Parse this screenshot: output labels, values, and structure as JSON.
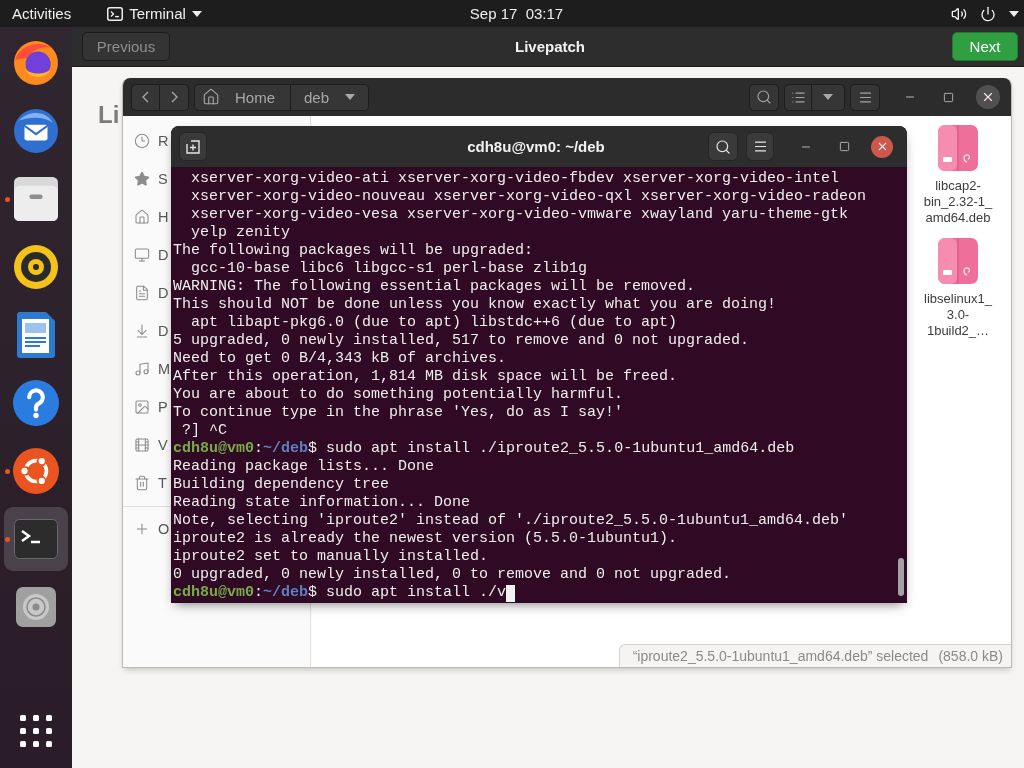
{
  "top_bar": {
    "activities": "Activities",
    "app_menu": "Terminal",
    "clock": "Sep 17  03:17"
  },
  "dock": {
    "items": [
      {
        "kind": "browser",
        "running": false,
        "active": false
      },
      {
        "kind": "mail",
        "running": false,
        "active": false
      },
      {
        "kind": "files",
        "running": true,
        "active": false
      },
      {
        "kind": "music",
        "running": false,
        "active": false
      },
      {
        "kind": "writer",
        "running": false,
        "active": false
      },
      {
        "kind": "help",
        "running": false,
        "active": false
      },
      {
        "kind": "software",
        "running": true,
        "active": false
      },
      {
        "kind": "terminal",
        "running": true,
        "active": true
      },
      {
        "kind": "disc",
        "running": false,
        "active": false
      }
    ]
  },
  "livepatch": {
    "previous": "Previous",
    "title": "Livepatch",
    "next": "Next",
    "heading": "Li"
  },
  "files_window": {
    "path": [
      {
        "kind": "home",
        "label": "Home"
      },
      {
        "kind": "current",
        "label": "deb"
      }
    ],
    "sidebar": {
      "items": [
        {
          "kind": "recent",
          "label": "R"
        },
        {
          "kind": "starred",
          "label": "S"
        },
        {
          "kind": "home",
          "label": "H"
        },
        {
          "kind": "desktop",
          "label": "D"
        },
        {
          "kind": "documents",
          "label": "D"
        },
        {
          "kind": "downloads",
          "label": "D"
        },
        {
          "kind": "music",
          "label": "M"
        },
        {
          "kind": "pictures",
          "label": "P"
        },
        {
          "kind": "videos",
          "label": "V"
        },
        {
          "kind": "trash",
          "label": "T"
        },
        {
          "kind": "other",
          "label": "O"
        }
      ]
    },
    "files": [
      {
        "name": "libcap2-\nbin_2.32-1_\namd64.deb"
      },
      {
        "name": "libselinux1_\n3.0-\n1build2_…"
      }
    ],
    "status": {
      "selection": "“iproute2_5.5.0-1ubuntu1_amd64.deb” selected",
      "size": "(858.0 kB)"
    }
  },
  "terminal": {
    "title": "cdh8u@vm0: ~/deb",
    "lines": [
      {
        "kind": "indented",
        "text": "xserver-xorg-video-ati xserver-xorg-video-fbdev xserver-xorg-video-intel"
      },
      {
        "kind": "indented",
        "text": "xserver-xorg-video-nouveau xserver-xorg-video-qxl xserver-xorg-video-radeon"
      },
      {
        "kind": "indented",
        "text": "xserver-xorg-video-vesa xserver-xorg-video-vmware xwayland yaru-theme-gtk"
      },
      {
        "kind": "indented",
        "text": "yelp zenity"
      },
      {
        "kind": "output",
        "text": "The following packages will be upgraded:"
      },
      {
        "kind": "indented",
        "text": "gcc-10-base libc6 libgcc-s1 perl-base zlib1g"
      },
      {
        "kind": "output",
        "text": "WARNING: The following essential packages will be removed."
      },
      {
        "kind": "output",
        "text": "This should NOT be done unless you know exactly what you are doing!"
      },
      {
        "kind": "indented",
        "text": "apt libapt-pkg6.0 (due to apt) libstdc++6 (due to apt)"
      },
      {
        "kind": "output",
        "text": "5 upgraded, 0 newly installed, 517 to remove and 0 not upgraded."
      },
      {
        "kind": "output",
        "text": "Need to get 0 B/4,343 kB of archives."
      },
      {
        "kind": "output",
        "text": "After this operation, 1,814 MB disk space will be freed."
      },
      {
        "kind": "output",
        "text": "You are about to do something potentially harmful."
      },
      {
        "kind": "output",
        "text": "To continue type in the phrase 'Yes, do as I say!'"
      },
      {
        "kind": "output",
        "text": " ?] ^C"
      },
      {
        "kind": "prompt",
        "user": "cdh8u@vm0",
        "colon": ":",
        "path": "~/deb",
        "symbol": "$",
        "command": "sudo apt install ./iproute2_5.5.0-1ubuntu1_amd64.deb",
        "cursor": false
      },
      {
        "kind": "output",
        "text": "Reading package lists... Done"
      },
      {
        "kind": "output",
        "text": "Building dependency tree"
      },
      {
        "kind": "output",
        "text": "Reading state information... Done"
      },
      {
        "kind": "output",
        "text": "Note, selecting 'iproute2' instead of './iproute2_5.5.0-1ubuntu1_amd64.deb'"
      },
      {
        "kind": "output",
        "text": "iproute2 is already the newest version (5.5.0-1ubuntu1)."
      },
      {
        "kind": "output",
        "text": "iproute2 set to manually installed."
      },
      {
        "kind": "output",
        "text": "0 upgraded, 0 newly installed, 0 to remove and 0 not upgraded."
      },
      {
        "kind": "prompt",
        "user": "cdh8u@vm0",
        "colon": ":",
        "path": "~/deb",
        "symbol": "$",
        "command": "sudo apt install ./v",
        "cursor": true
      }
    ]
  }
}
